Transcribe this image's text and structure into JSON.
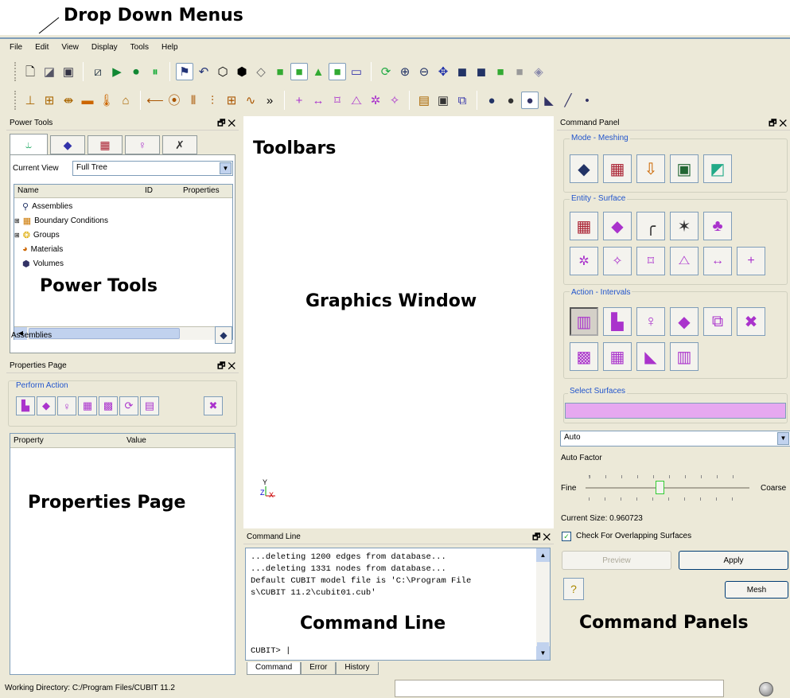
{
  "annotations": {
    "drop_down_menus": "Drop Down Menus",
    "toolbars": "Toolbars",
    "power_tools": "Power Tools",
    "graphics_window": "Graphics Window",
    "properties_page": "Properties Page",
    "command_line": "Command Line",
    "command_panels": "Command Panels"
  },
  "menu": [
    "File",
    "Edit",
    "View",
    "Display",
    "Tools",
    "Help"
  ],
  "power_tools": {
    "title": "Power Tools",
    "current_view_label": "Current View",
    "current_view_value": "Full Tree",
    "columns": [
      "Name",
      "ID",
      "Properties"
    ],
    "items": [
      "Assemblies",
      "Boundary Conditions",
      "Groups",
      "Materials",
      "Volumes"
    ],
    "footer_label": "Assemblies"
  },
  "properties_page": {
    "title": "Properties Page",
    "group_label": "Perform Action",
    "columns": [
      "Property",
      "Value"
    ]
  },
  "command_line": {
    "title": "Command Line",
    "lines": [
      "...deleting 1200 edges from database...",
      "...deleting 1331 nodes from database...",
      "Default CUBIT model file is 'C:\\Program File",
      "s\\CUBIT 11.2\\cubit01.cub'"
    ],
    "prompt": "CUBIT>",
    "tabs": [
      "Command",
      "Error",
      "History"
    ]
  },
  "command_panel": {
    "title": "Command Panel",
    "mode_label": "Mode - Meshing",
    "entity_label": "Entity - Surface",
    "action_label": "Action - Intervals",
    "select_label": "Select Surfaces",
    "select_color": "#e6a8f0",
    "dropdown_value": "Auto",
    "auto_factor_label": "Auto Factor",
    "fine_label": "Fine",
    "coarse_label": "Coarse",
    "auto_factor_level": 0.45,
    "current_size": "Current Size: 0.960723",
    "checkbox_label": "Check For Overlapping Surfaces",
    "checkbox_checked": true,
    "preview_label": "Preview",
    "apply_label": "Apply",
    "mesh_label": "Mesh"
  },
  "status": {
    "working_directory": "Working Directory: C:/Program Files/CUBIT 11.2"
  },
  "axis": {
    "y": "Y",
    "z": "Z",
    "x": "X"
  }
}
